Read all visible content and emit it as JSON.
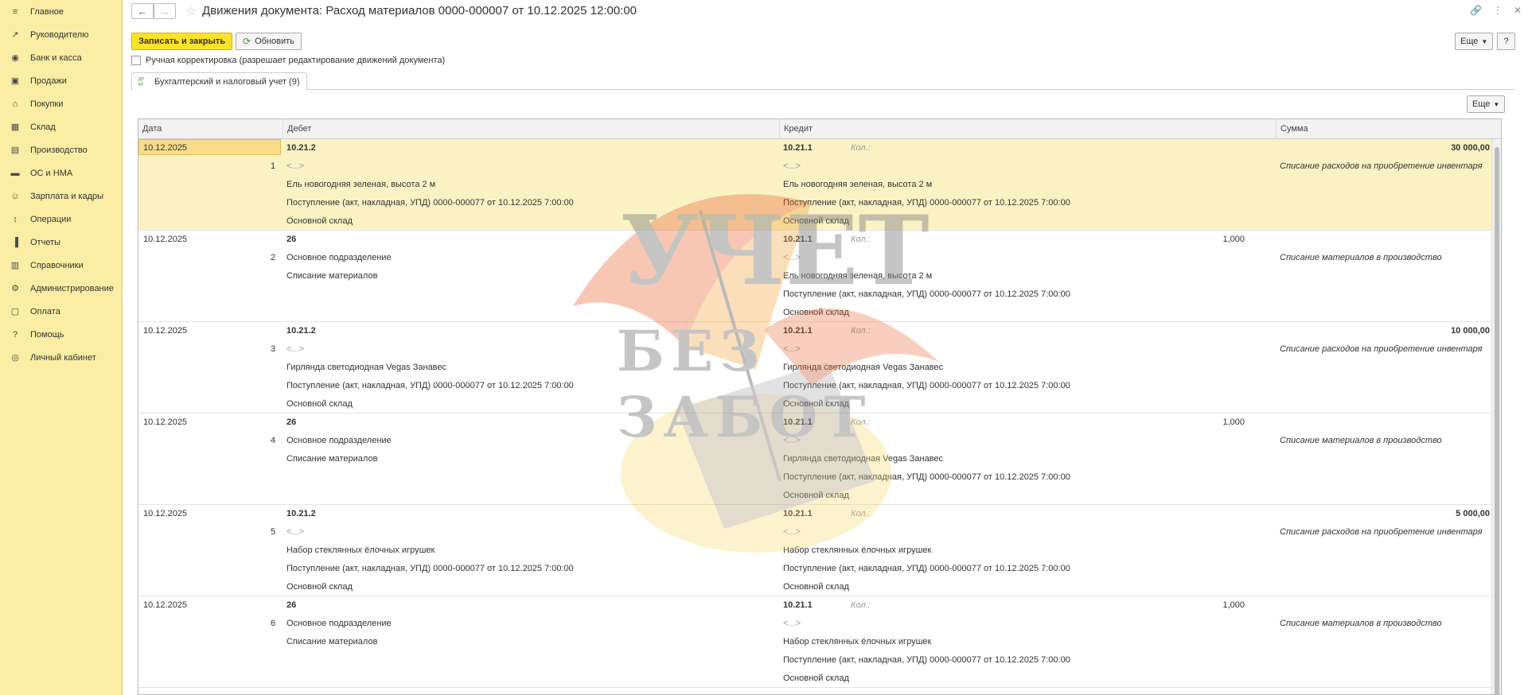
{
  "sidebar": {
    "items": [
      {
        "label": "Главное",
        "icon": "menu-icon"
      },
      {
        "label": "Руководителю",
        "icon": "trend-icon"
      },
      {
        "label": "Банк и касса",
        "icon": "bank-icon"
      },
      {
        "label": "Продажи",
        "icon": "bag-icon"
      },
      {
        "label": "Покупки",
        "icon": "cart-icon"
      },
      {
        "label": "Склад",
        "icon": "warehouse-icon"
      },
      {
        "label": "Производство",
        "icon": "factory-icon"
      },
      {
        "label": "ОС и НМА",
        "icon": "truck-icon"
      },
      {
        "label": "Зарплата и кадры",
        "icon": "people-icon"
      },
      {
        "label": "Операции",
        "icon": "dt-kt-icon"
      },
      {
        "label": "Отчеты",
        "icon": "bar-chart-icon"
      },
      {
        "label": "Справочники",
        "icon": "book-icon"
      },
      {
        "label": "Администрирование",
        "icon": "gear-icon"
      },
      {
        "label": "Оплата",
        "icon": "payment-icon"
      },
      {
        "label": "Помощь",
        "icon": "help-icon"
      },
      {
        "label": "Личный кабинет",
        "icon": "user-icon"
      }
    ]
  },
  "header": {
    "title": "Движения документа: Расход материалов 0000-000007 от 10.12.2025 12:00:00"
  },
  "toolbar": {
    "save_close_label": "Записать и закрыть",
    "refresh_label": "Обновить",
    "more_label": "Еще",
    "help_label": "?"
  },
  "manual_correction_label": "Ручная корректировка (разрешает редактирование движений документа)",
  "tab": {
    "label": "Бухгалтерский и налоговый учет (9)"
  },
  "table_more_label": "Еще",
  "columns": [
    "Дата",
    "Дебет",
    "Кредит",
    "Сумма"
  ],
  "kol_label": "Кол.:",
  "rows": [
    {
      "num": "1",
      "date": "10.12.2025",
      "debit": [
        "10.21.2",
        "<...>",
        "Ель новогодняя зеленая, высота 2 м",
        "Поступление (акт, накладная, УПД) 0000-000077 от 10.12.2025 7:00:00",
        "Основной склад"
      ],
      "debit_qty": "",
      "credit": [
        "10.21.1",
        "<...>",
        "Ель новогодняя зеленая, высота 2 м",
        "Поступление (акт, накладная, УПД) 0000-000077 от 10.12.2025 7:00:00",
        "Основной склад"
      ],
      "credit_qty": "",
      "sum": "30 000,00",
      "content": "Списание расходов на приобретение инвентаря"
    },
    {
      "num": "2",
      "date": "10.12.2025",
      "debit": [
        "26",
        "Основное подразделение",
        "Списание материалов",
        "",
        ""
      ],
      "debit_qty": "",
      "credit": [
        "10.21.1",
        "<...>",
        "Ель новогодняя зеленая, высота 2 м",
        "Поступление (акт, накладная, УПД) 0000-000077 от 10.12.2025 7:00:00",
        "Основной склад"
      ],
      "credit_qty": "1,000",
      "sum": "",
      "content": "Списание материалов в производство"
    },
    {
      "num": "3",
      "date": "10.12.2025",
      "debit": [
        "10.21.2",
        "<...>",
        "Гирлянда светодиодная Vegas Занавес",
        "Поступление (акт, накладная, УПД) 0000-000077 от 10.12.2025 7:00:00",
        "Основной склад"
      ],
      "debit_qty": "",
      "credit": [
        "10.21.1",
        "<...>",
        "Гирлянда светодиодная Vegas Занавес",
        "Поступление (акт, накладная, УПД) 0000-000077 от 10.12.2025 7:00:00",
        "Основной склад"
      ],
      "credit_qty": "",
      "sum": "10 000,00",
      "content": "Списание расходов на приобретение инвентаря"
    },
    {
      "num": "4",
      "date": "10.12.2025",
      "debit": [
        "26",
        "Основное подразделение",
        "Списание материалов",
        "",
        ""
      ],
      "debit_qty": "",
      "credit": [
        "10.21.1",
        "<...>",
        "Гирлянда светодиодная Vegas Занавес",
        "Поступление (акт, накладная, УПД) 0000-000077 от 10.12.2025 7:00:00",
        "Основной склад"
      ],
      "credit_qty": "1,000",
      "sum": "",
      "content": "Списание материалов в производство"
    },
    {
      "num": "5",
      "date": "10.12.2025",
      "debit": [
        "10.21.2",
        "<...>",
        "Набор стеклянных ёлочных игрушек",
        "Поступление (акт, накладная, УПД) 0000-000077 от 10.12.2025 7:00:00",
        "Основной склад"
      ],
      "debit_qty": "",
      "credit": [
        "10.21.1",
        "<...>",
        "Набор стеклянных ёлочных игрушек",
        "Поступление (акт, накладная, УПД) 0000-000077 от 10.12.2025 7:00:00",
        "Основной склад"
      ],
      "credit_qty": "",
      "sum": "5 000,00",
      "content": "Списание расходов на приобретение инвентаря"
    },
    {
      "num": "6",
      "date": "10.12.2025",
      "debit": [
        "26",
        "Основное подразделение",
        "Списание материалов",
        "",
        ""
      ],
      "debit_qty": "",
      "credit": [
        "10.21.1",
        "<...>",
        "Набор стеклянных ёлочных игрушек",
        "Поступление (акт, накладная, УПД) 0000-000077 от 10.12.2025 7:00:00",
        "Основной склад"
      ],
      "credit_qty": "1,000",
      "sum": "",
      "content": "Списание материалов в производство"
    }
  ],
  "watermark": {
    "line1": "УЧЕТ",
    "line2": "БЕЗ ЗАБОТ"
  }
}
